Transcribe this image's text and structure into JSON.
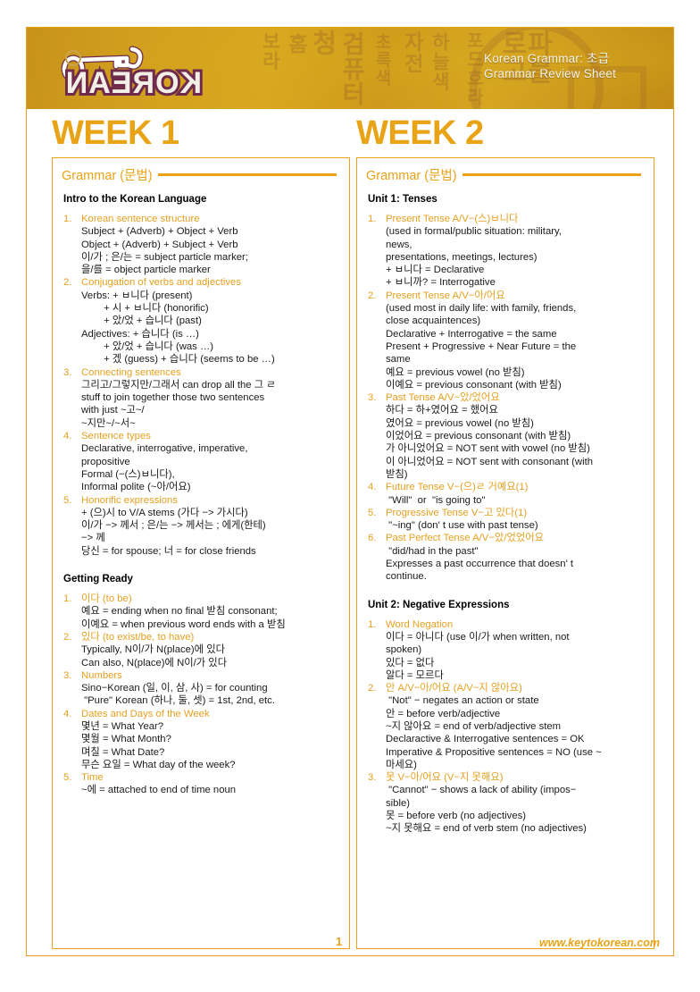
{
  "header": {
    "title_line1": "Korean Grammar: 초급",
    "title_line2": "Grammar Review Sheet",
    "logo_text": "KOREAN",
    "logo_icon": "key-icon",
    "watermark_chars": [
      "보라",
      "홈",
      "청",
      "검퓨터",
      "초록색",
      "자전",
      "하늘색",
      "포드흐라",
      "파블로고"
    ]
  },
  "footer": {
    "page_number": "1",
    "url": "www.keytokorean.com"
  },
  "weeks": [
    {
      "title": "WEEK 1",
      "panel_label": "Grammar (문법)",
      "sections": [
        {
          "heading": "Intro to the Korean Language",
          "items": [
            {
              "num": "1.",
              "title": "Korean sentence structure",
              "lines": [
                "Subject + (Adverb) + Object + Verb",
                "Object + (Adverb) + Subject + Verb",
                "이/가 ; 은/는 = subject particle marker;",
                "을/를 = object particle marker"
              ]
            },
            {
              "num": "2.",
              "title": "Conjugation of verbs and adjectives",
              "lines": [
                "Verbs: + ㅂ니다 (present)",
                "        + 시 + ㅂ니다 (honorific)",
                "        + 았/었 + 습니다 (past)",
                "Adjectives: + 습니다 (is …)",
                "        + 았/었 + 습니다 (was …)",
                "        + 겠 (guess) + 습니다 (seems to be …)"
              ]
            },
            {
              "num": "3.",
              "title": "Connecting sentences",
              "lines": [
                "그리고/그렇지만/그래서 can drop all the 그 ㄹ",
                "stuff to join together those two sentences",
                "with just ~고~/",
                "~지만~/~서~"
              ]
            },
            {
              "num": "4.",
              "title": "Sentence types",
              "lines": [
                "Declarative, interrogative, imperative,",
                "propositive",
                "Formal (−(스)ㅂ니다),",
                "Informal polite (~아/어요)"
              ]
            },
            {
              "num": "5.",
              "title": "Honorific expressions",
              "lines": [
                "+ (으)시 to V/A stems (가다 −> 가시다)",
                "이/가 −> 께서 ; 은/는 −> 께서는 ; 에게(한테)",
                "−> 께",
                "당신 = for spouse; 너 = for close friends"
              ]
            }
          ]
        },
        {
          "heading": "Getting Ready",
          "items": [
            {
              "num": "1.",
              "title": "이다 (to be)",
              "lines": [
                "예요 = ending when no final 받침 consonant;",
                "이예요 = when previous word ends with a 받침"
              ]
            },
            {
              "num": "2.",
              "title": "있다 (to exist/be, to have)",
              "lines": [
                "Typically, N이/가 N(place)에 있다",
                "Can also, N(place)에 N이/가 있다"
              ]
            },
            {
              "num": "3.",
              "title": "Numbers",
              "lines": [
                "Sino−Korean (일, 이, 삼, 사) = for counting",
                " \"Pure\" Korean (하나, 둘, 셋) = 1st, 2nd, etc."
              ]
            },
            {
              "num": "4.",
              "title": "Dates and Days of the Week",
              "lines": [
                "몇년 = What Year?",
                "몇월 = What Month?",
                "며칠 = What Date?",
                "무슨 요일 = What day of the week?"
              ]
            },
            {
              "num": "5.",
              "title": "Time",
              "lines": [
                "~에 = attached to end of time noun"
              ]
            }
          ]
        }
      ]
    },
    {
      "title": "WEEK 2",
      "panel_label": "Grammar (문법)",
      "sections": [
        {
          "heading": "Unit 1: Tenses",
          "items": [
            {
              "num": "1.",
              "title": "Present Tense A/V−(스)ㅂ니다",
              "lines": [
                "(used in formal/public situation: military,",
                "news,",
                "presentations, meetings, lectures)",
                "+ ㅂ니다 = Declarative",
                "+ ㅂ니까? = Interrogative"
              ]
            },
            {
              "num": "2.",
              "title": "Present Tense A/V−아/어요",
              "lines": [
                "(used most in daily life: with family, friends,",
                "close acquaintences)",
                "Declarative + Interrogative = the same",
                "Present + Progressive + Near Future = the",
                "same",
                "예요 = previous vowel (no 받침)",
                "이예요 = previous consonant (with 받침)"
              ]
            },
            {
              "num": "3.",
              "title": "Past Tense A/V−았/었어요",
              "lines": [
                "하다 = 하+였어요 = 했어요",
                "였어요 = previous vowel (no 받침)",
                "이었어요 = previous consonant (with 받침)",
                "가 아니었어요 = NOT sent with vowel (no 받침)",
                "이 아니었어요 = NOT sent with consonant (with",
                "받침)"
              ]
            },
            {
              "num": "4.",
              "title": "Future Tense V−(으)ㄹ 거예요(1)",
              "lines": [
                " \"Will\"  or  \"is going to\""
              ]
            },
            {
              "num": "5.",
              "title": "Progressive Tense V−고 있다(1)",
              "lines": [
                " \"~ing\" (don' t use with past tense)"
              ]
            },
            {
              "num": "6.",
              "title": "Past Perfect Tense A/V−았/었었어요",
              "lines": [
                " \"did/had in the past\"",
                "Expresses a past occurrence that doesn' t",
                "continue."
              ]
            }
          ]
        },
        {
          "heading": "Unit 2: Negative Expressions",
          "items": [
            {
              "num": "1.",
              "title": "Word Negation",
              "lines": [
                "이다 = 아니다 (use 이/가 when written, not",
                "spoken)",
                "있다 = 없다",
                "알다 = 모르다"
              ]
            },
            {
              "num": "2.",
              "title": "안 A/V−아/어요 (A/V−지 않아요)",
              "lines": [
                " \"Not\" − negates an action or state",
                "안 = before verb/adjective",
                "~지 않아요 = end of verb/adjective stem",
                "Declaractive & Interrogative sentences = OK",
                "Imperative & Propositive sentences = NO (use ~",
                "마세요)"
              ]
            },
            {
              "num": "3.",
              "title": "못 V−아/어요 (V−지 못해요)",
              "lines": [
                " \"Cannot\" − shows a lack of ability (impos−",
                "sible)",
                "못 = before verb (no adjectives)",
                "~지 못해요 = end of verb stem (no adjectives)"
              ]
            }
          ]
        }
      ]
    }
  ],
  "colors": {
    "accent": "#e8a317",
    "header_gold": "#d2a01e",
    "logo_outline": "#6e2b4b",
    "text": "#1a1a1a"
  }
}
